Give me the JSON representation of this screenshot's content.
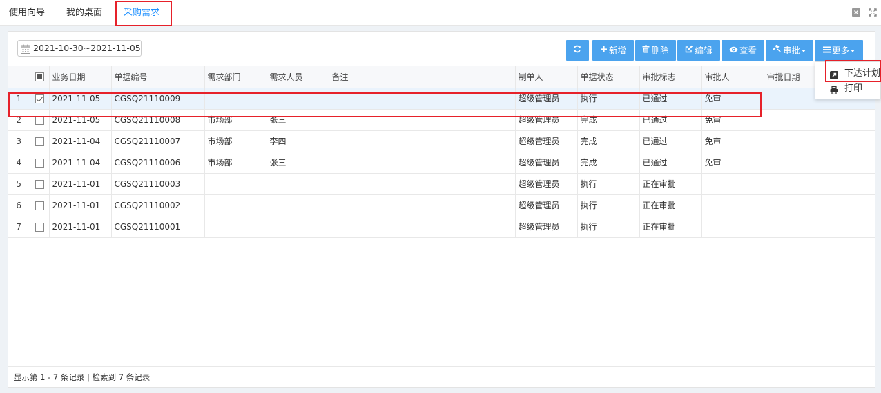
{
  "tabs": [
    {
      "label": "使用向导"
    },
    {
      "label": "我的桌面"
    },
    {
      "label": "采购需求"
    }
  ],
  "date_range": "2021-10-30~2021-11-05",
  "toolbar": {
    "refresh": "",
    "add": "新增",
    "delete": "删除",
    "edit": "编辑",
    "view": "查看",
    "approve": "审批",
    "more": "更多"
  },
  "dropdown": {
    "issue_plan": "下达计划",
    "print": "打印"
  },
  "columns": {
    "biz_date": "业务日期",
    "doc_no": "单据编号",
    "dept": "需求部门",
    "person": "需求人员",
    "remark": "备注",
    "maker": "制单人",
    "doc_status": "单据状态",
    "approval_flag": "审批标志",
    "approver": "审批人",
    "approval_date": "审批日期"
  },
  "rows": [
    {
      "idx": "1",
      "checked": true,
      "date": "2021-11-05",
      "no": "CGSQ21110009",
      "dept": "",
      "person": "",
      "remark": "",
      "maker": "超级管理员",
      "status": "执行",
      "flag": "已通过",
      "approver": "免审",
      "adate": ""
    },
    {
      "idx": "2",
      "checked": false,
      "date": "2021-11-05",
      "no": "CGSQ21110008",
      "dept": "市场部",
      "person": "张三",
      "remark": "",
      "maker": "超级管理员",
      "status": "完成",
      "flag": "已通过",
      "approver": "免审",
      "adate": ""
    },
    {
      "idx": "3",
      "checked": false,
      "date": "2021-11-04",
      "no": "CGSQ21110007",
      "dept": "市场部",
      "person": "李四",
      "remark": "",
      "maker": "超级管理员",
      "status": "完成",
      "flag": "已通过",
      "approver": "免审",
      "adate": ""
    },
    {
      "idx": "4",
      "checked": false,
      "date": "2021-11-04",
      "no": "CGSQ21110006",
      "dept": "市场部",
      "person": "张三",
      "remark": "",
      "maker": "超级管理员",
      "status": "完成",
      "flag": "已通过",
      "approver": "免审",
      "adate": ""
    },
    {
      "idx": "5",
      "checked": false,
      "date": "2021-11-01",
      "no": "CGSQ21110003",
      "dept": "",
      "person": "",
      "remark": "",
      "maker": "超级管理员",
      "status": "执行",
      "flag": "正在审批",
      "approver": "",
      "adate": ""
    },
    {
      "idx": "6",
      "checked": false,
      "date": "2021-11-01",
      "no": "CGSQ21110002",
      "dept": "",
      "person": "",
      "remark": "",
      "maker": "超级管理员",
      "status": "执行",
      "flag": "正在审批",
      "approver": "",
      "adate": ""
    },
    {
      "idx": "7",
      "checked": false,
      "date": "2021-11-01",
      "no": "CGSQ21110001",
      "dept": "",
      "person": "",
      "remark": "",
      "maker": "超级管理员",
      "status": "执行",
      "flag": "正在审批",
      "approver": "",
      "adate": ""
    }
  ],
  "footer": "显示第 1 - 7 条记录 | 检索到 7 条记录",
  "colors": {
    "accent": "#1e90ff",
    "button": "#4ba3ee",
    "highlight": "#e6212a"
  }
}
